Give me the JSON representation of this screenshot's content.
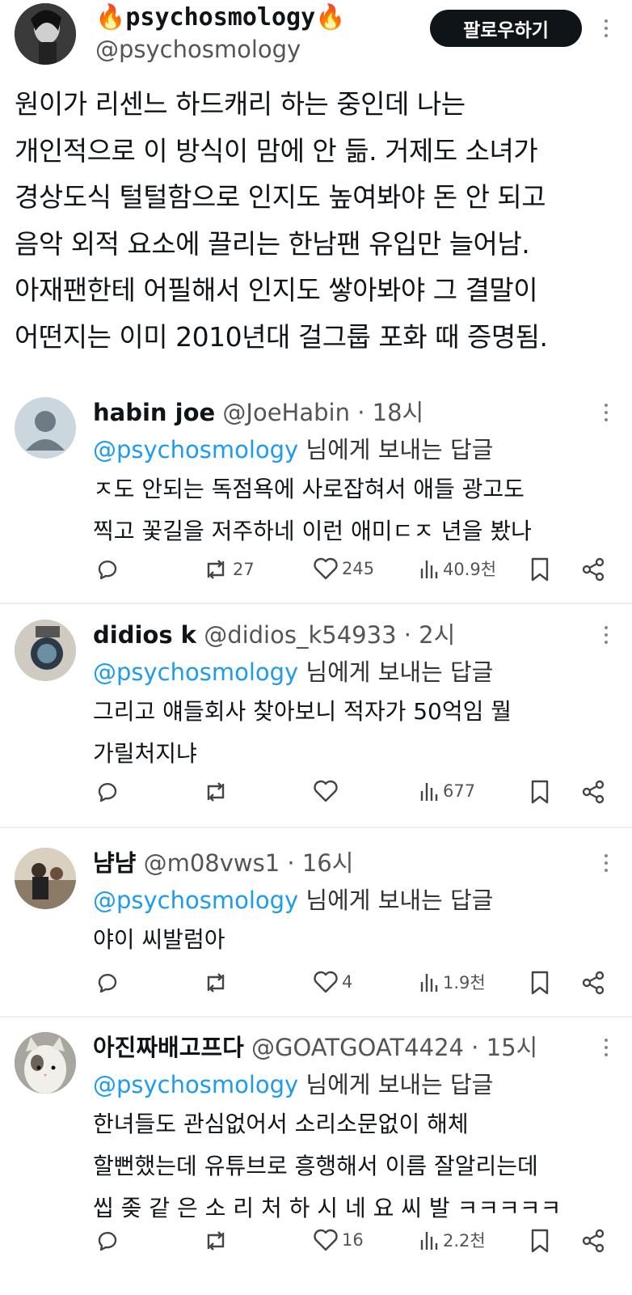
{
  "post": {
    "display_name": "🔥psychosmology🔥",
    "handle": "@psychosmology",
    "follow_label": "팔로우하기",
    "text_lines": [
      "원이가 리센느 하드캐리 하는 중인데 나는",
      "개인적으로 이 방식이 맘에 안 듦. 거제도 소녀가",
      "경상도식 털털함으로 인지도 높여봐야 돈 안 되고",
      "음악 외적 요소에 끌리는 한남팬 유입만 늘어남.",
      "아재팬한테 어필해서 인지도 쌓아봐야 그 결말이",
      "어떤지는 이미 2010년대 걸그룹 포화 때 증명됨."
    ]
  },
  "replies": [
    {
      "name": "habin joe",
      "meta": "@JoeHabin · 18시",
      "mention": "@psychosmology",
      "to_suffix": " 님에게 보내는 답글",
      "lines": [
        "ㅈ도 안되는 독점욕에 사로잡혀서 애들 광고도",
        "찍고 꽃길을 저주하네 이런 애미ㄷㅈ 년을 봤나"
      ],
      "retweets": "27",
      "likes": "245",
      "views": "40.9천"
    },
    {
      "name": "didios k",
      "meta": "@didios_k54933 · 2시",
      "mention": "@psychosmology",
      "to_suffix": " 님에게 보내는 답글",
      "lines": [
        "그리고 얘들회사 찾아보니 적자가 50억임 뭘",
        "가릴처지냐"
      ],
      "retweets": "",
      "likes": "",
      "views": "677"
    },
    {
      "name": "냠냠",
      "meta": "@m08vws1 · 16시",
      "mention": "@psychosmology",
      "to_suffix": " 님에게 보내는 답글",
      "lines": [
        "야이 씨발럼아"
      ],
      "retweets": "",
      "likes": "4",
      "views": "1.9천"
    },
    {
      "name": "아진짜배고프다",
      "meta": "@GOATGOAT4424 · 15시",
      "mention": "@psychosmology",
      "to_suffix": " 님에게 보내는 답글",
      "lines": [
        "한녀들도 관심없어서 소리소문없이 해체",
        "할뻔했는데 유튜브로 흥행해서 이름 잘알리는데",
        "씹 좆 같 은 소 리 처 하 시 네 요 씨 발 ㅋㅋㅋㅋㅋ"
      ],
      "retweets": "",
      "likes": "16",
      "views": "2.2천"
    }
  ],
  "icons": {
    "reply": "reply-icon",
    "retweet": "retweet-icon",
    "like": "heart-icon",
    "views": "views-icon",
    "bookmark": "bookmark-icon",
    "share": "share-icon"
  },
  "colors": {
    "mention": "#1d9bf0",
    "text": "#0f1419",
    "muted": "#555555",
    "button": "#0f1419"
  }
}
